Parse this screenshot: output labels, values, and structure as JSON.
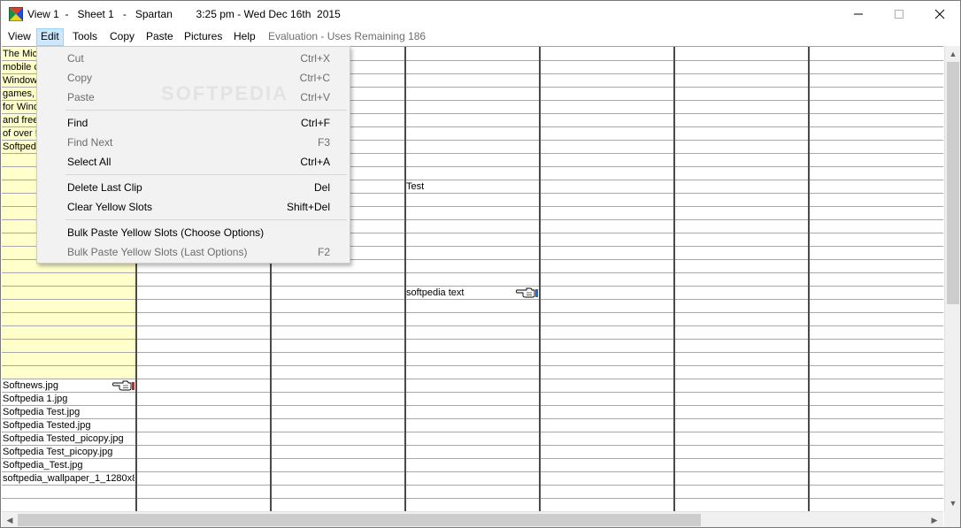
{
  "window": {
    "title": "View 1  -   Sheet 1   -   Spartan        3:25 pm - Wed Dec 16th  2015",
    "minimize_icon": "minimize-icon",
    "maximize_icon": "maximize-icon",
    "close_icon": "close-icon"
  },
  "menubar": {
    "items": [
      "View",
      "Edit",
      "Tools",
      "Copy",
      "Paste",
      "Pictures",
      "Help"
    ],
    "active": "Edit",
    "evaluation": "Evaluation - Uses Remaining 186"
  },
  "edit_menu": {
    "items": [
      {
        "label": "Cut",
        "shortcut": "Ctrl+X",
        "enabled": false
      },
      {
        "label": "Copy",
        "shortcut": "Ctrl+C",
        "enabled": false
      },
      {
        "label": "Paste",
        "shortcut": "Ctrl+V",
        "enabled": false
      },
      {
        "label": "Find",
        "shortcut": "Ctrl+F",
        "enabled": true
      },
      {
        "label": "Find Next",
        "shortcut": "F3",
        "enabled": false
      },
      {
        "label": "Select All",
        "shortcut": "Ctrl+A",
        "enabled": true
      },
      {
        "label": "Delete Last Clip",
        "shortcut": "Del",
        "enabled": true
      },
      {
        "label": "Clear Yellow Slots",
        "shortcut": "Shift+Del",
        "enabled": true
      },
      {
        "label": "Bulk Paste Yellow Slots (Choose Options)",
        "shortcut": "",
        "enabled": true
      },
      {
        "label": "Bulk Paste Yellow Slots (Last Options)",
        "shortcut": "F2",
        "enabled": false
      }
    ]
  },
  "sheet": {
    "yellow_column_lines": [
      "The Mic",
      "mobile c",
      "Window",
      "games,",
      "for Wind",
      "and free",
      "of over !",
      "Softped"
    ],
    "col3_cells": [
      "Test",
      "softpedia text"
    ],
    "file_list": [
      "Softnews.jpg",
      "Softpedia 1.jpg",
      "Softpedia Test.jpg",
      "Softpedia Tested.jpg",
      "Softpedia Tested_picopy.jpg",
      "Softpedia Test_picopy.jpg",
      "Softpedia_Test.jpg",
      "softpedia_wallpaper_1_1280x8"
    ]
  },
  "watermark": "SOFTPEDIA",
  "colors": {
    "yellow_slot": "#ffffcc",
    "menu_active": "#cce8ff",
    "menu_background": "#f2f2f2",
    "disabled_text": "#6d6d6d"
  },
  "icons": {
    "app": "spartan-app-icon",
    "pointer": "pointing-hand-icon"
  }
}
